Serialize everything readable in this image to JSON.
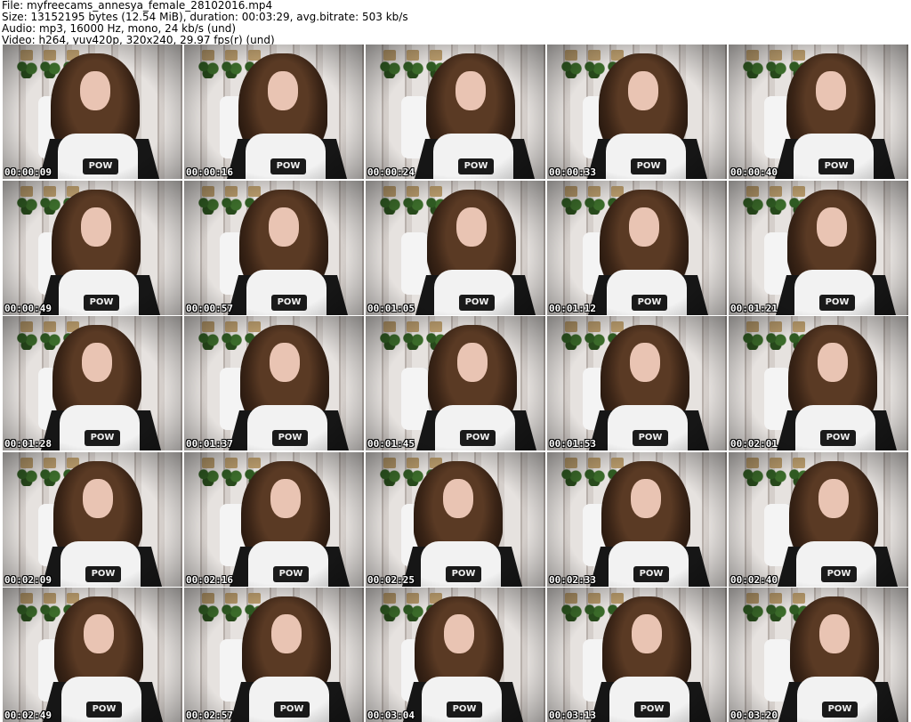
{
  "header": {
    "file": "File: myfreecams_annesya_female_28102016.mp4",
    "size": "Size: 13152195 bytes (12.54 MiB), duration: 00:03:29, avg.bitrate: 503 kb/s",
    "audio": "Audio: mp3, 16000 Hz, mono, 24 kb/s (und)",
    "video": "Video: h264, yuv420p, 320x240, 29.97 fps(r) (und)"
  },
  "thumbnails": [
    {
      "time": "00:00:09"
    },
    {
      "time": "00:00:16"
    },
    {
      "time": "00:00:24"
    },
    {
      "time": "00:00:33"
    },
    {
      "time": "00:00:40"
    },
    {
      "time": "00:00:49"
    },
    {
      "time": "00:00:57"
    },
    {
      "time": "00:01:05"
    },
    {
      "time": "00:01:12"
    },
    {
      "time": "00:01:21"
    },
    {
      "time": "00:01:28"
    },
    {
      "time": "00:01:37"
    },
    {
      "time": "00:01:45"
    },
    {
      "time": "00:01:53"
    },
    {
      "time": "00:02:01"
    },
    {
      "time": "00:02:09"
    },
    {
      "time": "00:02:16"
    },
    {
      "time": "00:02:25"
    },
    {
      "time": "00:02:33"
    },
    {
      "time": "00:02:40"
    },
    {
      "time": "00:02:49"
    },
    {
      "time": "00:02:57"
    },
    {
      "time": "00:03:04"
    },
    {
      "time": "00:03:13"
    },
    {
      "time": "00:03:20"
    }
  ],
  "shirt_text": "POW",
  "colors": {
    "background": "#ffffff",
    "timestamp_text": "#ffffff"
  }
}
